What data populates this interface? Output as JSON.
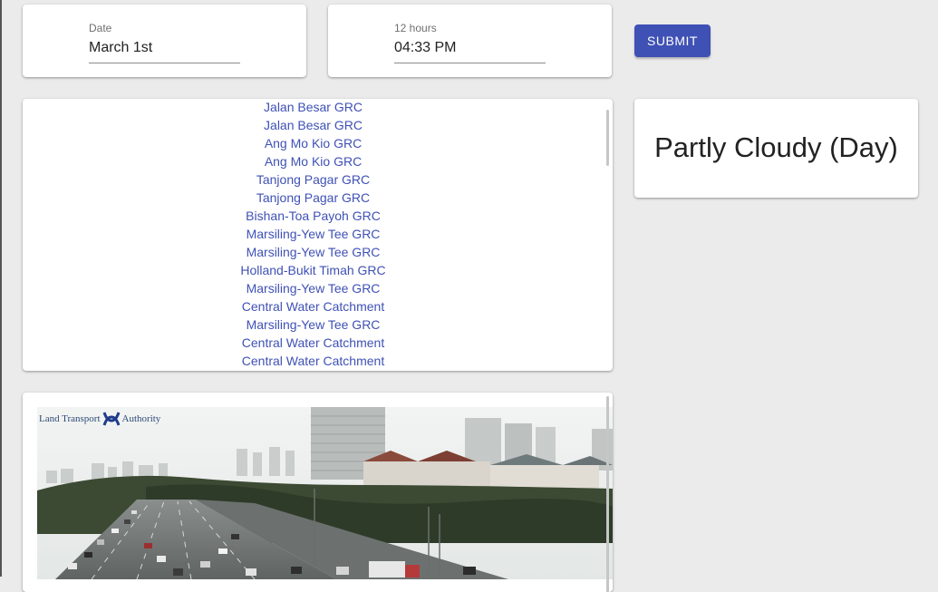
{
  "date_picker": {
    "label": "Date",
    "value": "March 1st"
  },
  "time_picker": {
    "label": "12 hours",
    "value": "04:33 PM"
  },
  "submit": {
    "label": "SUBMIT"
  },
  "areas": [
    "Jalan Besar GRC",
    "Jalan Besar GRC",
    "Ang Mo Kio GRC",
    "Ang Mo Kio GRC",
    "Tanjong Pagar GRC",
    "Tanjong Pagar GRC",
    "Bishan-Toa Payoh GRC",
    "Marsiling-Yew Tee GRC",
    "Marsiling-Yew Tee GRC",
    "Holland-Bukit Timah GRC",
    "Marsiling-Yew Tee GRC",
    "Central Water Catchment",
    "Marsiling-Yew Tee GRC",
    "Central Water Catchment",
    "Central Water Catchment"
  ],
  "forecast": {
    "text": "Partly Cloudy (Day)"
  },
  "camera": {
    "logo_left": "Land Transport",
    "logo_right": "Authority"
  },
  "colors": {
    "accent": "#3f51b5",
    "background": "#ebebeb"
  }
}
